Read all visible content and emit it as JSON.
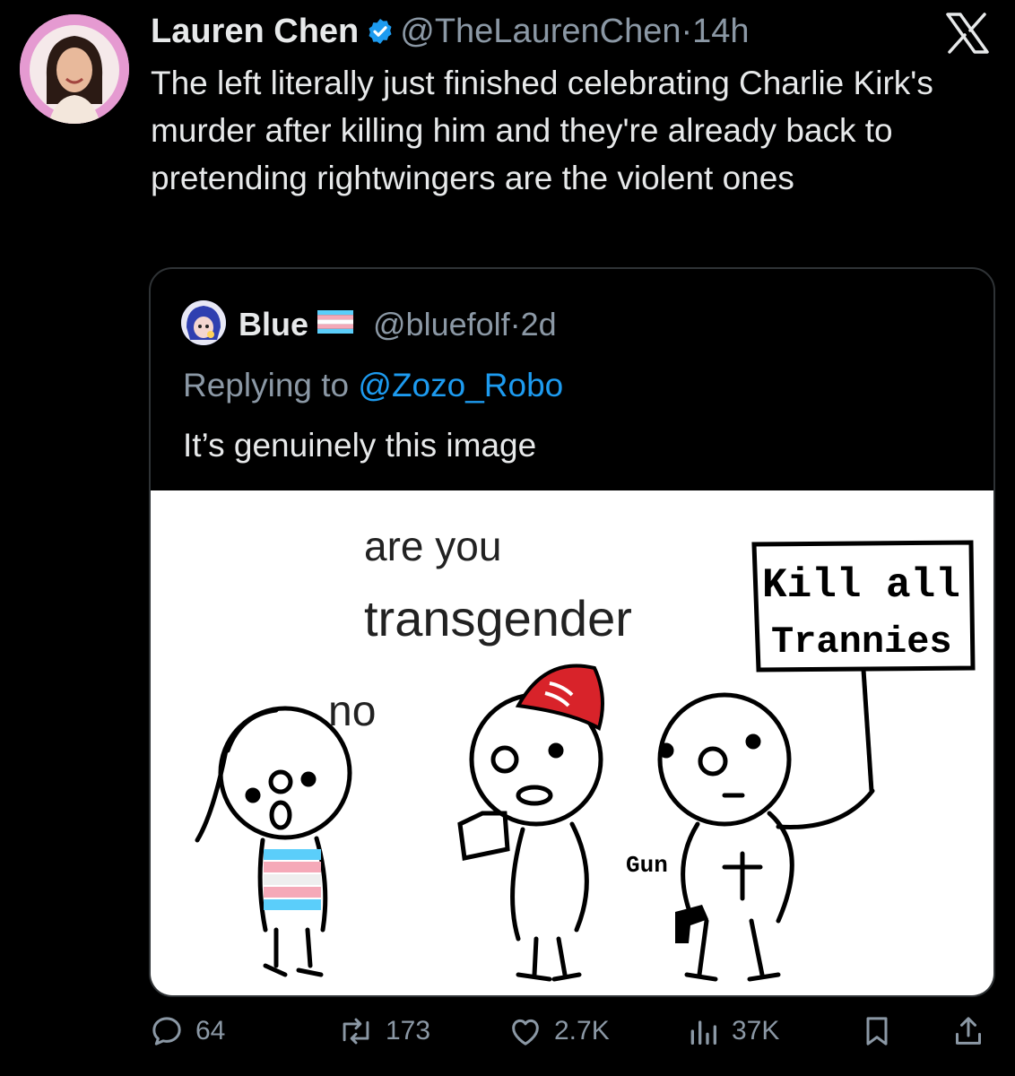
{
  "tweet": {
    "author_name": "Lauren Chen",
    "author_handle": "@TheLaurenChen",
    "separator": "·",
    "time": "14h",
    "text": "The left literally just finished celebrating Charlie Kirk's murder after killing him and they're already back to pretending rightwingers are the violent ones"
  },
  "quote": {
    "author_name": "Blue",
    "author_handle": "@bluefolf",
    "separator": "·",
    "time": "2d",
    "replying_prefix": "Replying to ",
    "replying_to": "@Zozo_Robo",
    "text": "It’s genuinely this image"
  },
  "meme": {
    "caption_line1": "are you",
    "caption_line2": "transgender",
    "reply": "no",
    "sign_line1": "Kill all",
    "sign_line2": "Trannies",
    "gun_label": "Gun"
  },
  "actions": {
    "replies": "64",
    "reposts": "173",
    "likes": "2.7K",
    "views": "37K"
  },
  "colors": {
    "background": "#000000",
    "text": "#e7e9ea",
    "secondary": "#8b98a5",
    "link": "#1d9bf0",
    "verified": "#1d9bf0",
    "avatar_bg": "#e59ad1"
  }
}
